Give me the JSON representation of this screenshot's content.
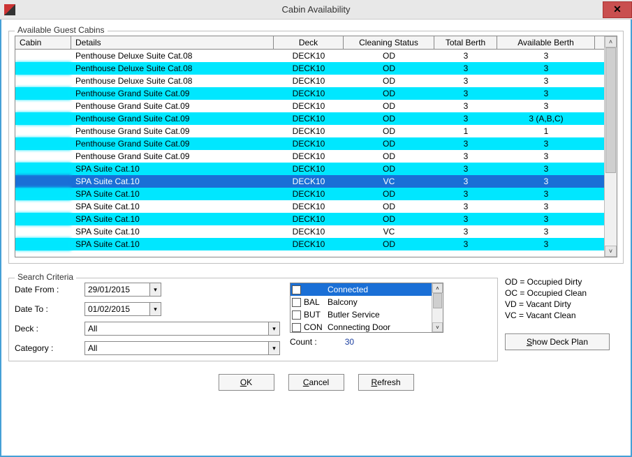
{
  "window": {
    "title": "Cabin Availability"
  },
  "group_cabins_title": "Available Guest Cabins",
  "columns": [
    "Cabin",
    "Details",
    "Deck",
    "Cleaning Status",
    "Total Berth",
    "Available Berth"
  ],
  "rows": [
    {
      "cabin": "",
      "details": "Penthouse Deluxe Suite Cat.08",
      "deck": "DECK10",
      "cleaning": "OD",
      "total": "3",
      "avail": "3",
      "hl": false
    },
    {
      "cabin": "",
      "details": "Penthouse Deluxe Suite Cat.08",
      "deck": "DECK10",
      "cleaning": "OD",
      "total": "3",
      "avail": "3",
      "hl": true
    },
    {
      "cabin": "",
      "details": "Penthouse Deluxe Suite Cat.08",
      "deck": "DECK10",
      "cleaning": "OD",
      "total": "3",
      "avail": "3",
      "hl": false
    },
    {
      "cabin": "",
      "details": "Penthouse Grand Suite Cat.09",
      "deck": "DECK10",
      "cleaning": "OD",
      "total": "3",
      "avail": "3",
      "hl": true
    },
    {
      "cabin": "",
      "details": "Penthouse Grand Suite Cat.09",
      "deck": "DECK10",
      "cleaning": "OD",
      "total": "3",
      "avail": "3",
      "hl": false
    },
    {
      "cabin": "",
      "details": "Penthouse Grand Suite Cat.09",
      "deck": "DECK10",
      "cleaning": "OD",
      "total": "3",
      "avail": "3 (A,B,C)",
      "hl": true
    },
    {
      "cabin": "",
      "details": "Penthouse Grand Suite Cat.09",
      "deck": "DECK10",
      "cleaning": "OD",
      "total": "1",
      "avail": "1",
      "hl": false
    },
    {
      "cabin": "",
      "details": "Penthouse Grand Suite Cat.09",
      "deck": "DECK10",
      "cleaning": "OD",
      "total": "3",
      "avail": "3",
      "hl": true
    },
    {
      "cabin": "",
      "details": "Penthouse Grand Suite Cat.09",
      "deck": "DECK10",
      "cleaning": "OD",
      "total": "3",
      "avail": "3",
      "hl": false
    },
    {
      "cabin": "",
      "details": "SPA Suite Cat.10",
      "deck": "DECK10",
      "cleaning": "OD",
      "total": "3",
      "avail": "3",
      "hl": true
    },
    {
      "cabin": "",
      "details": "SPA Suite Cat.10",
      "deck": "DECK10",
      "cleaning": "VC",
      "total": "3",
      "avail": "3",
      "sel": true
    },
    {
      "cabin": "",
      "details": "SPA Suite Cat.10",
      "deck": "DECK10",
      "cleaning": "OD",
      "total": "3",
      "avail": "3",
      "hl": true
    },
    {
      "cabin": "",
      "details": "SPA Suite Cat.10",
      "deck": "DECK10",
      "cleaning": "OD",
      "total": "3",
      "avail": "3",
      "hl": false
    },
    {
      "cabin": "",
      "details": "SPA Suite Cat.10",
      "deck": "DECK10",
      "cleaning": "OD",
      "total": "3",
      "avail": "3",
      "hl": true
    },
    {
      "cabin": "",
      "details": "SPA Suite Cat.10",
      "deck": "DECK10",
      "cleaning": "VC",
      "total": "3",
      "avail": "3",
      "hl": false
    },
    {
      "cabin": "",
      "details": "SPA Suite Cat.10",
      "deck": "DECK10",
      "cleaning": "OD",
      "total": "3",
      "avail": "3",
      "hl": true
    }
  ],
  "search": {
    "title": "Search Criteria",
    "date_from_label": "Date From :",
    "date_from_value": "29/01/2015",
    "date_to_label": "Date To :",
    "date_to_value": "01/02/2015",
    "deck_label": "Deck :",
    "deck_value": "All",
    "category_label": "Category :",
    "category_value": "All",
    "count_label": "Count :",
    "count_value": "30",
    "features": [
      {
        "code": "",
        "name": "Connected",
        "sel": true
      },
      {
        "code": "BAL",
        "name": "Balcony",
        "sel": false
      },
      {
        "code": "BUT",
        "name": "Butler Service",
        "sel": false
      },
      {
        "code": "CON",
        "name": "Connecting Door",
        "sel": false
      }
    ]
  },
  "legend": {
    "od": "OD = Occupied Dirty",
    "oc": "OC = Occupied Clean",
    "vd": "VD = Vacant Dirty",
    "vc": "VC = Vacant Clean"
  },
  "buttons": {
    "deck_plan": "Show Deck Plan",
    "ok": "OK",
    "cancel": "Cancel",
    "refresh": "Refresh"
  }
}
